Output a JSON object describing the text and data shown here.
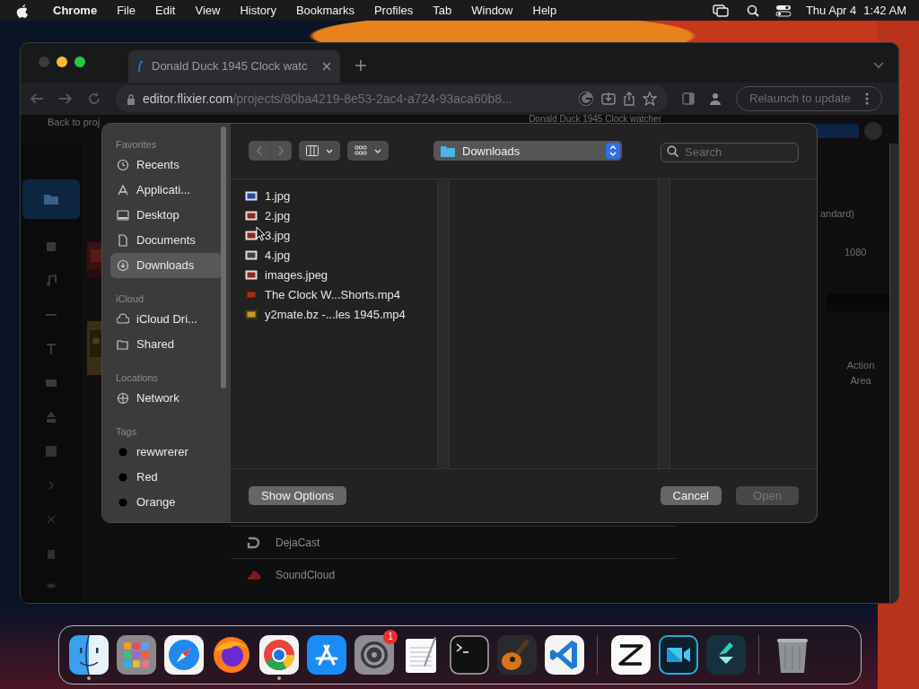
{
  "menubar": {
    "app": "Chrome",
    "menus": [
      "File",
      "Edit",
      "View",
      "History",
      "Bookmarks",
      "Profiles",
      "Tab",
      "Window",
      "Help"
    ],
    "date": "Thu Apr 4",
    "time": "1:42 AM"
  },
  "browser": {
    "tabs": [
      {
        "title": "Donald Duck 1945 Clock watc",
        "selected": true
      }
    ],
    "url_host": "editor.flixier.com",
    "url_path": "/projects/80ba4219-8e53-2ac4-a724-93aca60b8...",
    "relaunch": "Relaunch to update"
  },
  "editor": {
    "back_link": "Back to proj",
    "project_title": "Donald Duck 1945 Clock watcher",
    "resolution": "andard)",
    "height_value": "1080",
    "column_heading": "Action",
    "column_heading_2": "Area",
    "sources": [
      {
        "label": "DejaCast",
        "kind": "dejacast"
      },
      {
        "label": "SoundCloud",
        "kind": "soundcloud"
      }
    ]
  },
  "dialog": {
    "sidebar": [
      {
        "heading": "Favorites",
        "items": [
          {
            "label": "Recents",
            "kind": "clock",
            "selected": false
          },
          {
            "label": "Applicati...",
            "kind": "apps",
            "selected": false
          },
          {
            "label": "Desktop",
            "kind": "desktop",
            "selected": false
          },
          {
            "label": "Documents",
            "kind": "document",
            "selected": false
          },
          {
            "label": "Downloads",
            "kind": "download",
            "selected": true
          }
        ]
      },
      {
        "heading": "iCloud",
        "items": [
          {
            "label": "iCloud Dri...",
            "kind": "cloud",
            "selected": false
          },
          {
            "label": "Shared",
            "kind": "shared",
            "selected": false
          }
        ]
      },
      {
        "heading": "Locations",
        "items": [
          {
            "label": "Network",
            "kind": "globe",
            "selected": false
          }
        ]
      },
      {
        "heading": "Tags",
        "items": [
          {
            "label": "rewwrerer",
            "kind": "tag",
            "selected": false
          },
          {
            "label": "Red",
            "kind": "tag",
            "selected": false
          },
          {
            "label": "Orange",
            "kind": "tag",
            "selected": false
          }
        ]
      }
    ],
    "nav_back_disabled": true,
    "nav_forward_disabled": true,
    "location": "Downloads",
    "search": {
      "placeholder": "Search"
    },
    "files": [
      {
        "name": "1.jpg",
        "kind": "image-blue"
      },
      {
        "name": "2.jpg",
        "kind": "image-red"
      },
      {
        "name": "3.jpg",
        "kind": "image-red"
      },
      {
        "name": "4.jpg",
        "kind": "image-grey"
      },
      {
        "name": "images.jpeg",
        "kind": "image-red"
      },
      {
        "name": "The Clock W...Shorts.mp4",
        "kind": "video-red"
      },
      {
        "name": "y2mate.bz -...les 1945.mp4",
        "kind": "video-yellow"
      }
    ],
    "buttons": [
      {
        "label": "Show Options",
        "kind": "secondary",
        "disabled": false
      },
      {
        "label": "Cancel",
        "kind": "secondary",
        "disabled": false
      },
      {
        "label": "Open",
        "kind": "primary",
        "disabled": true
      }
    ]
  },
  "dock": [
    {
      "kind": "finder",
      "running": true
    },
    {
      "kind": "launchpad",
      "running": false
    },
    {
      "kind": "safari",
      "running": false
    },
    {
      "kind": "firefox",
      "running": false
    },
    {
      "kind": "chrome",
      "running": true
    },
    {
      "kind": "appstore",
      "running": false
    },
    {
      "kind": "settings",
      "running": false,
      "badge": "1"
    },
    {
      "kind": "textedit",
      "running": false
    },
    {
      "kind": "terminal",
      "running": false
    },
    {
      "kind": "guitar",
      "running": false
    },
    {
      "kind": "vscode",
      "running": false
    },
    {
      "kind": "separator"
    },
    {
      "kind": "capcut",
      "running": false
    },
    {
      "kind": "recorder",
      "running": false
    },
    {
      "kind": "filmora",
      "running": false
    },
    {
      "kind": "separator"
    },
    {
      "kind": "trash",
      "running": false
    }
  ]
}
